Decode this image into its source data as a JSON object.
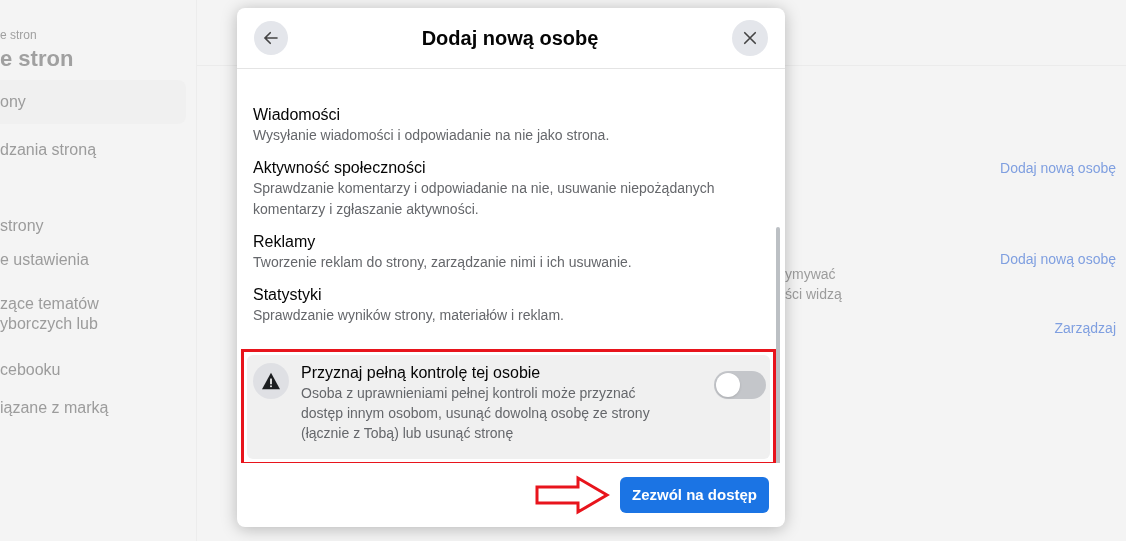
{
  "sidebar": {
    "breadcrumb": "e stron",
    "title": "e stron",
    "items": [
      {
        "label": "ony",
        "selected": true
      },
      {
        "label": "dzania stroną",
        "selected": false
      },
      {
        "label": "strony",
        "selected": false
      },
      {
        "label": "e ustawienia",
        "selected": false
      },
      {
        "label": "zące tematów\nyborczych lub",
        "selected": false
      },
      {
        "label": "cebooku",
        "selected": false
      },
      {
        "label": "iązane z marką",
        "selected": false
      }
    ]
  },
  "background": {
    "links": [
      "Dodaj nową osobę",
      "Dodaj nową osobę",
      "Zarządzaj"
    ],
    "text_fragment": "ymywać\nści widzą"
  },
  "dialog": {
    "title": "Dodaj nową osobę",
    "permissions": [
      {
        "title": "Wiadomości",
        "description": "Wysyłanie wiadomości i odpowiadanie na nie jako strona."
      },
      {
        "title": "Aktywność społeczności",
        "description": "Sprawdzanie komentarzy i odpowiadanie na nie, usuwanie niepożądanych komentarzy i zgłaszanie aktywności."
      },
      {
        "title": "Reklamy",
        "description": "Tworzenie reklam do strony, zarządzanie nimi i ich usuwanie."
      },
      {
        "title": "Statystyki",
        "description": "Sprawdzanie wyników strony, materiałów i reklam."
      }
    ],
    "full_control": {
      "title": "Przyznaj pełną kontrolę tej osobie",
      "description": "Osoba z uprawnieniami pełnej kontroli może przyznać dostęp innym osobom, usunąć dowolną osobę ze strony (łącznie z Tobą) lub usunąć stronę",
      "on": false
    },
    "submit": "Zezwól na dostęp"
  }
}
